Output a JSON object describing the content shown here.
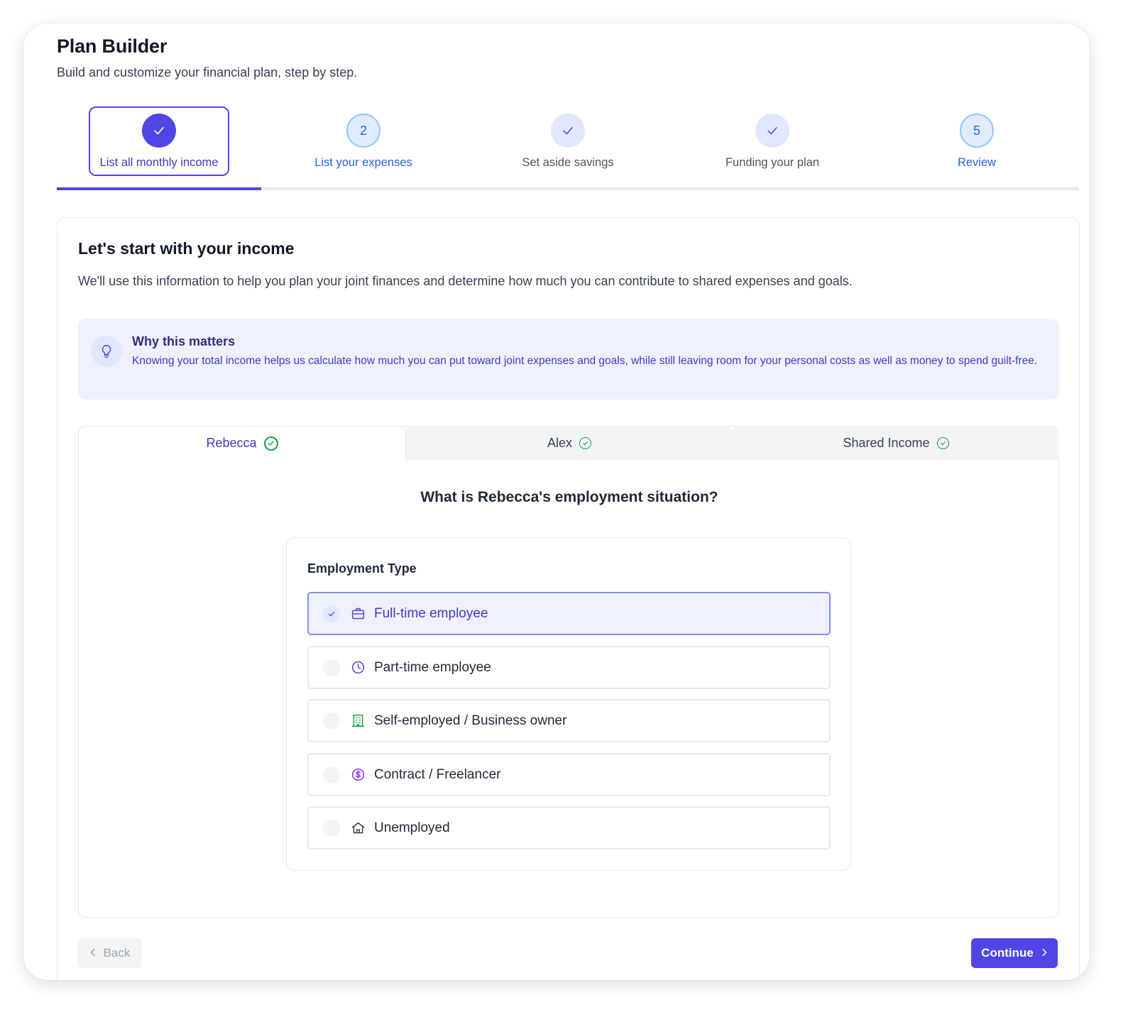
{
  "header": {
    "title": "Plan Builder",
    "subtitle": "Build and customize your financial plan, step by step."
  },
  "stepper": {
    "progress_fraction": 0.2,
    "steps": [
      {
        "label": "List all monthly income",
        "marker": "check",
        "state": "active"
      },
      {
        "label": "List your expenses",
        "marker": "2",
        "state": "upcoming"
      },
      {
        "label": "Set aside savings",
        "marker": "check",
        "state": "completed"
      },
      {
        "label": "Funding your plan",
        "marker": "check",
        "state": "completed"
      },
      {
        "label": "Review",
        "marker": "5",
        "state": "upcoming"
      }
    ]
  },
  "section": {
    "title": "Let's start with your income",
    "description": "We'll use this information to help you plan your joint finances and determine how much you can contribute to shared expenses and goals."
  },
  "info": {
    "icon": "lightbulb-icon",
    "title": "Why this matters",
    "text": "Knowing your total income helps us calculate how much you can put toward joint expenses and goals, while still leaving room for your personal costs as well as money to spend guilt-free."
  },
  "tabs": [
    {
      "label": "Rebecca",
      "active": true,
      "icon": "check-circle-icon"
    },
    {
      "label": "Alex",
      "active": false,
      "icon": "check-circle-icon"
    },
    {
      "label": "Shared Income",
      "active": false,
      "icon": "check-circle-icon"
    }
  ],
  "question": "What is Rebecca's employment situation?",
  "employment": {
    "label": "Employment Type",
    "selected": "Full-time employee",
    "options": [
      {
        "label": "Full-time employee",
        "icon": "briefcase-icon",
        "color": "#4f46e5"
      },
      {
        "label": "Part-time employee",
        "icon": "clock-icon",
        "color": "#4f46e5"
      },
      {
        "label": "Self-employed / Business owner",
        "icon": "building-icon",
        "color": "#16a34a"
      },
      {
        "label": "Contract / Freelancer",
        "icon": "dollar-circle-icon",
        "color": "#9333ea"
      },
      {
        "label": "Unemployed",
        "icon": "home-icon",
        "color": "#374151"
      }
    ]
  },
  "footer": {
    "back_label": "Back",
    "continue_label": "Continue"
  },
  "colors": {
    "accent": "#4f46e5",
    "success": "#16a34a",
    "info_bg": "#eef2ff"
  }
}
